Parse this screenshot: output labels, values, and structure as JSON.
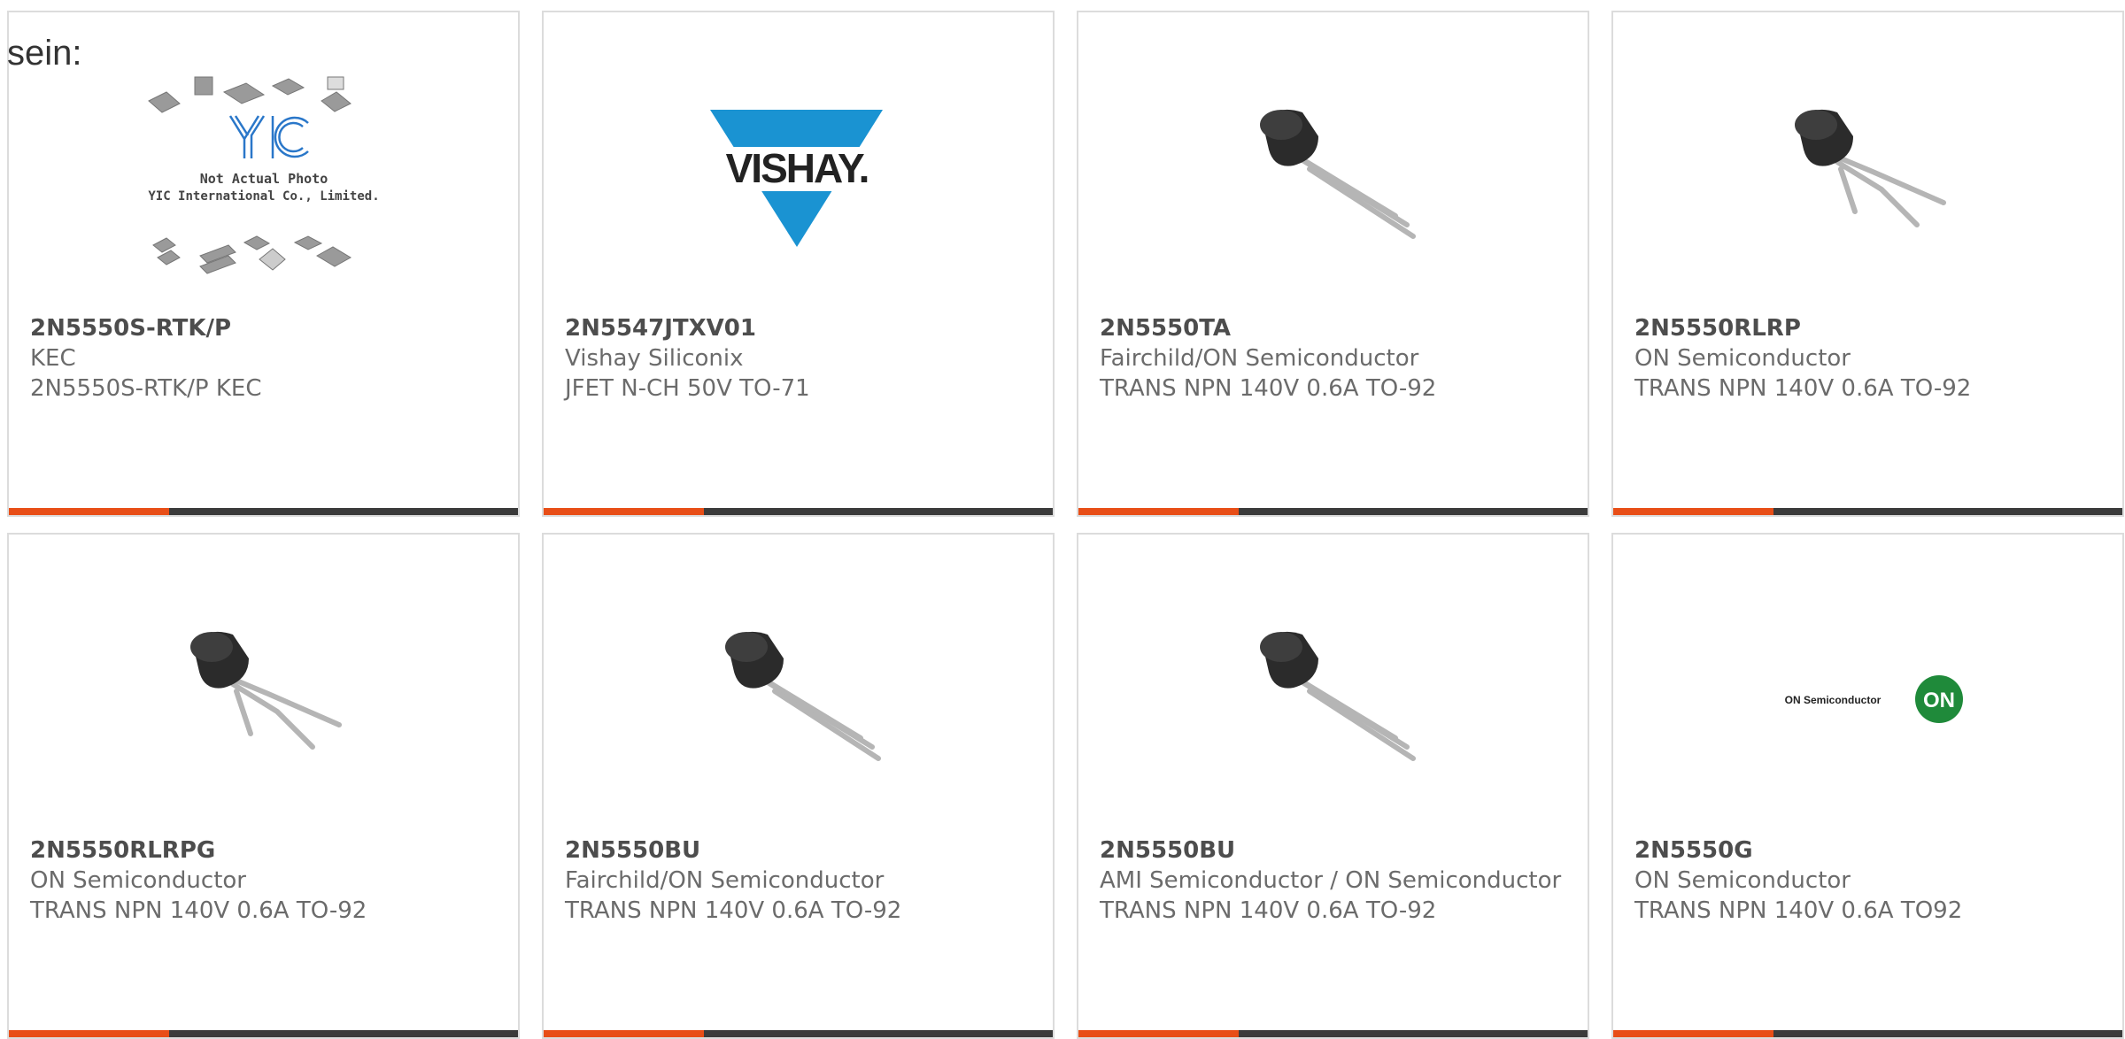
{
  "intro_text": "sein:",
  "colors": {
    "accent": "#e84e17",
    "bar": "#3b3b3b",
    "border": "#dcdcdc",
    "vishay_blue": "#1a93d2",
    "on_green": "#1f8a3a"
  },
  "products": [
    {
      "part": "2N5550S-RTK/P",
      "maker": "KEC",
      "desc": "2N5550S-RTK/P KEC",
      "image": "placeholder-photo",
      "image_text_1": "Not Actual Photo",
      "image_text_2": "YIC International Co., Limited.",
      "logo_text": "YIC"
    },
    {
      "part": "2N5547JTXV01",
      "maker": "Vishay Siliconix",
      "desc": "JFET N-CH 50V TO-71",
      "image": "vishay-logo",
      "logo_text": "VISHAY."
    },
    {
      "part": "2N5550TA",
      "maker": "Fairchild/ON Semiconductor",
      "desc": "TRANS NPN 140V 0.6A TO-92",
      "image": "to92-straight"
    },
    {
      "part": "2N5550RLRP",
      "maker": "ON Semiconductor",
      "desc": "TRANS NPN 140V 0.6A TO-92",
      "image": "to92-bent"
    },
    {
      "part": "2N5550RLRPG",
      "maker": "ON Semiconductor",
      "desc": "TRANS NPN 140V 0.6A TO-92",
      "image": "to92-bent"
    },
    {
      "part": "2N5550BU",
      "maker": "Fairchild/ON Semiconductor",
      "desc": "TRANS NPN 140V 0.6A TO-92",
      "image": "to92-straight"
    },
    {
      "part": "2N5550BU",
      "maker": "AMI Semiconductor / ON Semiconductor",
      "desc": "TRANS NPN 140V 0.6A TO-92",
      "image": "to92-straight"
    },
    {
      "part": "2N5550G",
      "maker": "ON Semiconductor",
      "desc": "TRANS NPN 140V 0.6A TO92",
      "image": "on-logo",
      "logo_text": "ON Semiconductor",
      "logo_mark": "ON"
    }
  ]
}
